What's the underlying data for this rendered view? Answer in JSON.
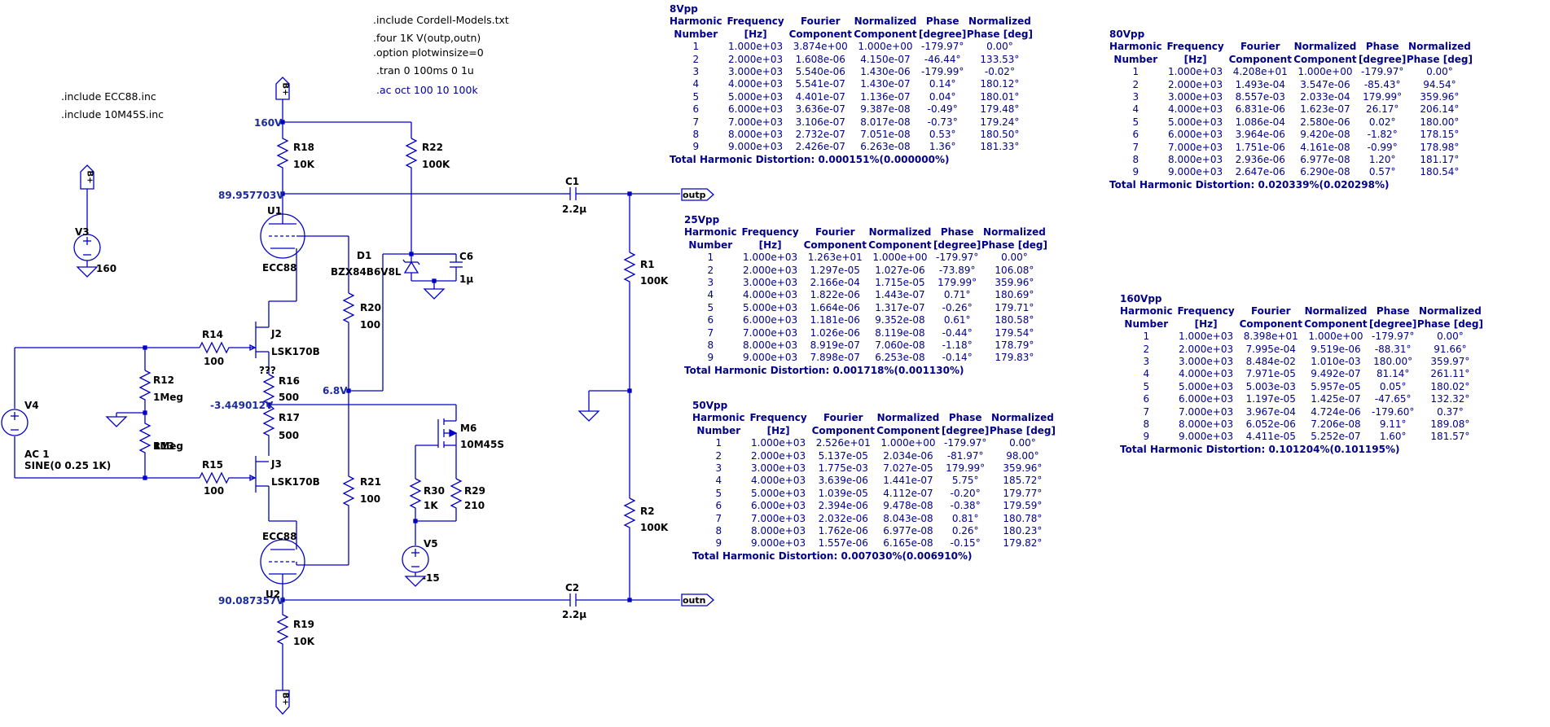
{
  "directives": {
    "include_cordell": ".include Cordell-Models.txt",
    "four": ".four 1K V(outp,outn)",
    "option": ".option plotwinsize=0",
    "tran": ".tran 0 100ms 0 1u",
    "ac": ".ac oct 100 10 100k",
    "include_ecc88": ".include ECC88.inc",
    "include_10m45s": ".include 10M45S.inc"
  },
  "components": {
    "r18": {
      "name": "R18",
      "value": "10K"
    },
    "r22": {
      "name": "R22",
      "value": "100K"
    },
    "r1": {
      "name": "R1",
      "value": "100K"
    },
    "r2": {
      "name": "R2",
      "value": "100K"
    },
    "r14": {
      "name": "R14",
      "value": "100"
    },
    "r15": {
      "name": "R15",
      "value": "100"
    },
    "r12": {
      "name": "R12",
      "value": "1Meg"
    },
    "r13": {
      "name": "R13",
      "value": "1Meg"
    },
    "r16": {
      "name": "R16",
      "value": "500",
      "note": "???"
    },
    "r17": {
      "name": "R17",
      "value": "500"
    },
    "r20": {
      "name": "R20",
      "value": "100"
    },
    "r21": {
      "name": "R21",
      "value": "100"
    },
    "r19": {
      "name": "R19",
      "value": "10K"
    },
    "r30": {
      "name": "R30",
      "value": "1K"
    },
    "r29": {
      "name": "R29",
      "value": "210"
    },
    "c1": {
      "name": "C1",
      "value": "2.2µ"
    },
    "c2": {
      "name": "C2",
      "value": "2.2µ"
    },
    "c6": {
      "name": "C6",
      "value": "1µ"
    },
    "d1": {
      "name": "D1",
      "value": "BZX84B6V8L"
    },
    "u1": {
      "name": "U1",
      "value": "ECC88"
    },
    "u2": {
      "name": "U2",
      "value": "ECC88"
    },
    "j2": {
      "name": "J2",
      "value": "LSK170B"
    },
    "j3": {
      "name": "J3",
      "value": "LSK170B"
    },
    "m6": {
      "name": "M6",
      "value": "10M45S"
    },
    "v3": {
      "name": "V3",
      "value": "160"
    },
    "v4": {
      "name": "V4",
      "value1": "AC 1",
      "value2": "SINE(0 0.25 1K)"
    },
    "v5": {
      "name": "V5",
      "value": "-15"
    }
  },
  "ports": {
    "outp": "outp",
    "outn": "outn",
    "bplus": "B+"
  },
  "node_voltages": {
    "v160": "160V",
    "v_anode1": "89.957703V",
    "v_68": "6.8V",
    "v_src": "-3.449012V",
    "v_anode2": "90.087357V"
  },
  "fourier_tables": [
    {
      "title": "8Vpp",
      "headers": [
        [
          "Harmonic",
          "Number"
        ],
        [
          "Frequency",
          "[Hz]"
        ],
        [
          "Fourier",
          "Component"
        ],
        [
          "Normalized",
          "Component"
        ],
        [
          "Phase",
          "[degree]"
        ],
        [
          "Normalized",
          "Phase [deg]"
        ]
      ],
      "rows": [
        [
          "1",
          "1.000e+03",
          "3.874e+00",
          "1.000e+00",
          "-179.97°",
          "0.00°"
        ],
        [
          "2",
          "2.000e+03",
          "1.608e-06",
          "4.150e-07",
          "-46.44°",
          "133.53°"
        ],
        [
          "3",
          "3.000e+03",
          "5.540e-06",
          "1.430e-06",
          "-179.99°",
          "-0.02°"
        ],
        [
          "4",
          "4.000e+03",
          "5.541e-07",
          "1.430e-07",
          "0.14°",
          "180.12°"
        ],
        [
          "5",
          "5.000e+03",
          "4.401e-07",
          "1.136e-07",
          "0.04°",
          "180.01°"
        ],
        [
          "6",
          "6.000e+03",
          "3.636e-07",
          "9.387e-08",
          "-0.49°",
          "179.48°"
        ],
        [
          "7",
          "7.000e+03",
          "3.106e-07",
          "8.017e-08",
          "-0.73°",
          "179.24°"
        ],
        [
          "8",
          "8.000e+03",
          "2.732e-07",
          "7.051e-08",
          "0.53°",
          "180.50°"
        ],
        [
          "9",
          "9.000e+03",
          "2.426e-07",
          "6.263e-08",
          "1.36°",
          "181.33°"
        ]
      ],
      "thd": "Total Harmonic Distortion: 0.000151%(0.000000%)"
    },
    {
      "title": "80Vpp",
      "headers": [
        [
          "Harmonic",
          "Number"
        ],
        [
          "Frequency",
          "[Hz]"
        ],
        [
          "Fourier",
          "Component"
        ],
        [
          "Normalized",
          "Component"
        ],
        [
          "Phase",
          "[degree]"
        ],
        [
          "Normalized",
          "Phase [deg]"
        ]
      ],
      "rows": [
        [
          "1",
          "1.000e+03",
          "4.208e+01",
          "1.000e+00",
          "-179.97°",
          "0.00°"
        ],
        [
          "2",
          "2.000e+03",
          "1.493e-04",
          "3.547e-06",
          "-85.43°",
          "94.54°"
        ],
        [
          "3",
          "3.000e+03",
          "8.557e-03",
          "2.033e-04",
          "179.99°",
          "359.96°"
        ],
        [
          "4",
          "4.000e+03",
          "6.831e-06",
          "1.623e-07",
          "26.17°",
          "206.14°"
        ],
        [
          "5",
          "5.000e+03",
          "1.086e-04",
          "2.580e-06",
          "0.02°",
          "180.00°"
        ],
        [
          "6",
          "6.000e+03",
          "3.964e-06",
          "9.420e-08",
          "-1.82°",
          "178.15°"
        ],
        [
          "7",
          "7.000e+03",
          "1.751e-06",
          "4.161e-08",
          "-0.99°",
          "178.98°"
        ],
        [
          "8",
          "8.000e+03",
          "2.936e-06",
          "6.977e-08",
          "1.20°",
          "181.17°"
        ],
        [
          "9",
          "9.000e+03",
          "2.647e-06",
          "6.290e-08",
          "0.57°",
          "180.54°"
        ]
      ],
      "thd": "Total Harmonic Distortion: 0.020339%(0.020298%)"
    },
    {
      "title": "25Vpp",
      "headers": [
        [
          "Harmonic",
          "Number"
        ],
        [
          "Frequency",
          "[Hz]"
        ],
        [
          "Fourier",
          "Component"
        ],
        [
          "Normalized",
          "Component"
        ],
        [
          "Phase",
          "[degree]"
        ],
        [
          "Normalized",
          "Phase [deg]"
        ]
      ],
      "rows": [
        [
          "1",
          "1.000e+03",
          "1.263e+01",
          "1.000e+00",
          "-179.97°",
          "0.00°"
        ],
        [
          "2",
          "2.000e+03",
          "1.297e-05",
          "1.027e-06",
          "-73.89°",
          "106.08°"
        ],
        [
          "3",
          "3.000e+03",
          "2.166e-04",
          "1.715e-05",
          "179.99°",
          "359.96°"
        ],
        [
          "4",
          "4.000e+03",
          "1.822e-06",
          "1.443e-07",
          "0.71°",
          "180.69°"
        ],
        [
          "5",
          "5.000e+03",
          "1.664e-06",
          "1.317e-07",
          "-0.26°",
          "179.71°"
        ],
        [
          "6",
          "6.000e+03",
          "1.181e-06",
          "9.352e-08",
          "0.61°",
          "180.58°"
        ],
        [
          "7",
          "7.000e+03",
          "1.026e-06",
          "8.119e-08",
          "-0.44°",
          "179.54°"
        ],
        [
          "8",
          "8.000e+03",
          "8.919e-07",
          "7.060e-08",
          "-1.18°",
          "178.79°"
        ],
        [
          "9",
          "9.000e+03",
          "7.898e-07",
          "6.253e-08",
          "-0.14°",
          "179.83°"
        ]
      ],
      "thd": "Total Harmonic Distortion: 0.001718%(0.001130%)"
    },
    {
      "title": "160Vpp",
      "headers": [
        [
          "Harmonic",
          "Number"
        ],
        [
          "Frequency",
          "[Hz]"
        ],
        [
          "Fourier",
          "Component"
        ],
        [
          "Normalized",
          "Component"
        ],
        [
          "Phase",
          "[degree]"
        ],
        [
          "Normalized",
          "Phase [deg]"
        ]
      ],
      "rows": [
        [
          "1",
          "1.000e+03",
          "8.398e+01",
          "1.000e+00",
          "-179.97°",
          "0.00°"
        ],
        [
          "2",
          "2.000e+03",
          "7.995e-04",
          "9.519e-06",
          "-88.31°",
          "91.66°"
        ],
        [
          "3",
          "3.000e+03",
          "8.484e-02",
          "1.010e-03",
          "180.00°",
          "359.97°"
        ],
        [
          "4",
          "4.000e+03",
          "7.971e-05",
          "9.492e-07",
          "81.14°",
          "261.11°"
        ],
        [
          "5",
          "5.000e+03",
          "5.003e-03",
          "5.957e-05",
          "0.05°",
          "180.02°"
        ],
        [
          "6",
          "6.000e+03",
          "1.197e-05",
          "1.425e-07",
          "-47.65°",
          "132.32°"
        ],
        [
          "7",
          "7.000e+03",
          "3.967e-04",
          "4.724e-06",
          "-179.60°",
          "0.37°"
        ],
        [
          "8",
          "8.000e+03",
          "6.052e-06",
          "7.206e-08",
          "9.11°",
          "189.08°"
        ],
        [
          "9",
          "9.000e+03",
          "4.411e-05",
          "5.252e-07",
          "1.60°",
          "181.57°"
        ]
      ],
      "thd": "Total Harmonic Distortion: 0.101204%(0.101195%)"
    },
    {
      "title": "50Vpp",
      "headers": [
        [
          "Harmonic",
          "Number"
        ],
        [
          "Frequency",
          "[Hz]"
        ],
        [
          "Fourier",
          "Component"
        ],
        [
          "Normalized",
          "Component"
        ],
        [
          "Phase",
          "[degree]"
        ],
        [
          "Normalized",
          "Phase [deg]"
        ]
      ],
      "rows": [
        [
          "1",
          "1.000e+03",
          "2.526e+01",
          "1.000e+00",
          "-179.97°",
          "0.00°"
        ],
        [
          "2",
          "2.000e+03",
          "5.137e-05",
          "2.034e-06",
          "-81.97°",
          "98.00°"
        ],
        [
          "3",
          "3.000e+03",
          "1.775e-03",
          "7.027e-05",
          "179.99°",
          "359.96°"
        ],
        [
          "4",
          "4.000e+03",
          "3.639e-06",
          "1.441e-07",
          "5.75°",
          "185.72°"
        ],
        [
          "5",
          "5.000e+03",
          "1.039e-05",
          "4.112e-07",
          "-0.20°",
          "179.77°"
        ],
        [
          "6",
          "6.000e+03",
          "2.394e-06",
          "9.478e-08",
          "-0.38°",
          "179.59°"
        ],
        [
          "7",
          "7.000e+03",
          "2.032e-06",
          "8.043e-08",
          "0.81°",
          "180.78°"
        ],
        [
          "8",
          "8.000e+03",
          "1.762e-06",
          "6.977e-08",
          "0.26°",
          "180.23°"
        ],
        [
          "9",
          "9.000e+03",
          "1.557e-06",
          "6.165e-08",
          "-0.15°",
          "179.82°"
        ]
      ],
      "thd": "Total Harmonic Distortion: 0.007030%(0.006910%)"
    }
  ]
}
